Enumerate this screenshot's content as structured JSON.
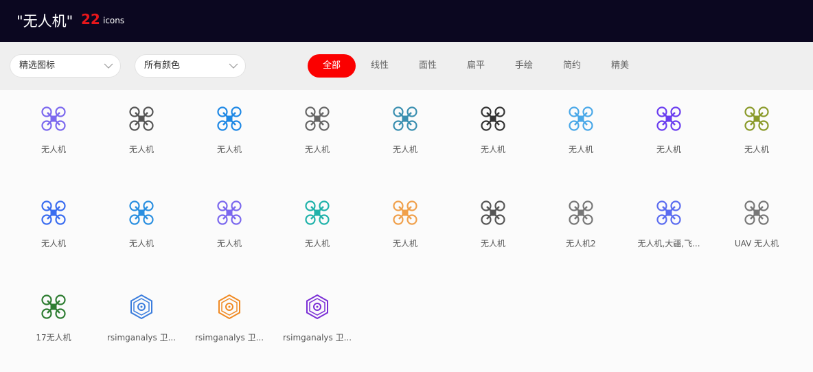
{
  "header": {
    "title": "\"无人机\"",
    "count": "22",
    "unit": "icons"
  },
  "filters": {
    "select1": "精选图标",
    "select2": "所有颜色",
    "tabs": [
      "全部",
      "线性",
      "面性",
      "扁平",
      "手绘",
      "简约",
      "精美"
    ],
    "active_tab": 0
  },
  "icons": [
    {
      "label": "无人机",
      "icon": "drone-purple-icon",
      "color": "#7b68ee"
    },
    {
      "label": "无人机",
      "icon": "drone-gray-dashed-icon",
      "color": "#555555"
    },
    {
      "label": "无人机",
      "icon": "drone-blue-icon",
      "color": "#1e88e5"
    },
    {
      "label": "无人机",
      "icon": "drone-gray-icon",
      "color": "#666666"
    },
    {
      "label": "无人机",
      "icon": "drone-teal-icon",
      "color": "#3a8fb0"
    },
    {
      "label": "无人机",
      "icon": "drone-black-icon",
      "color": "#333333"
    },
    {
      "label": "无人机",
      "icon": "drone-lightblue-icon",
      "color": "#4aa8e8"
    },
    {
      "label": "无人机",
      "icon": "drone-violet-icon",
      "color": "#6a3df0"
    },
    {
      "label": "无人机",
      "icon": "drone-olive-icon",
      "color": "#8a9a2a"
    },
    {
      "label": "无人机",
      "icon": "drone-colorful-x-icon",
      "color": "#3a6df0"
    },
    {
      "label": "无人机",
      "icon": "drone-side-blue-icon",
      "color": "#2a8fe0"
    },
    {
      "label": "无人机",
      "icon": "drone-purple-outline-icon",
      "color": "#7b68ee"
    },
    {
      "label": "无人机",
      "icon": "drone-teal-side-icon",
      "color": "#20b2aa"
    },
    {
      "label": "无人机",
      "icon": "drone-orange-circle-icon",
      "color": "#f0a04b"
    },
    {
      "label": "无人机",
      "icon": "drone-outline-gray-icon",
      "color": "#555555"
    },
    {
      "label": "无人机2",
      "icon": "drone-side-gray-icon",
      "color": "#777777"
    },
    {
      "label": "无人机,大疆,飞...",
      "icon": "drone-blue-purple-icon",
      "color": "#5b6cf0"
    },
    {
      "label": "UAV 无人机",
      "icon": "drone-thin-outline-icon",
      "color": "#777777"
    },
    {
      "label": "17无人机",
      "icon": "drone-green-side-icon",
      "color": "#2e7d32"
    },
    {
      "label": "rsimganalys 卫...",
      "icon": "hexagon-blue-icon",
      "color": "#3b7ddd"
    },
    {
      "label": "rsimganalys 卫...",
      "icon": "hexagon-orange-icon",
      "color": "#f08a24"
    },
    {
      "label": "rsimganalys 卫...",
      "icon": "hexagon-purple-icon",
      "color": "#7b2fd6"
    }
  ]
}
